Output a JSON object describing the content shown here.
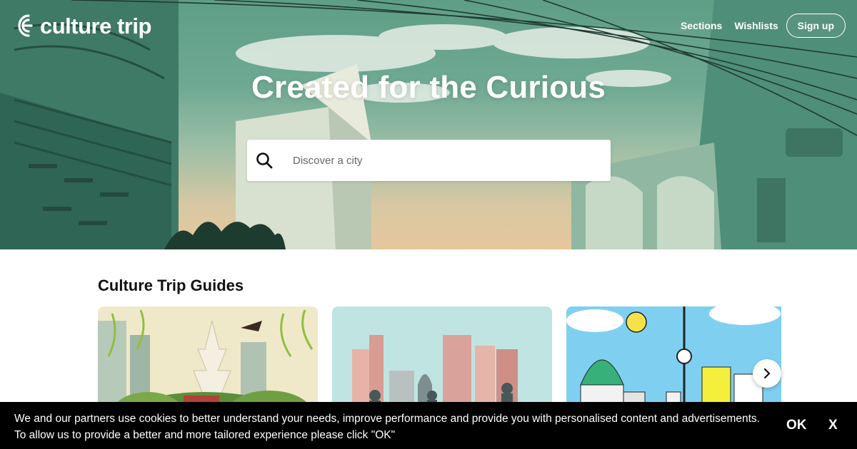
{
  "brand": {
    "name": "culture trip"
  },
  "nav": {
    "sections": "Sections",
    "wishlists": "Wishlists",
    "signup": "Sign up"
  },
  "hero": {
    "title": "Created for the Curious"
  },
  "search": {
    "placeholder": "Discover a city"
  },
  "guides": {
    "title": "Culture Trip Guides",
    "cards": [
      {
        "illustration": "beijing-illustration"
      },
      {
        "illustration": "london-illustration"
      },
      {
        "illustration": "berlin-illustration"
      }
    ]
  },
  "cookie_banner": {
    "line1": "We and our partners use cookies to better understand your needs, improve performance and provide you with personalised content and advertisements.",
    "line2": "To allow us to provide a better and more tailored experience please click \"OK\"",
    "ok": "OK",
    "close": "X"
  },
  "colors": {
    "hero_green": "#6fa994",
    "cookie_bg": "#000000",
    "text_dark": "#111111"
  }
}
